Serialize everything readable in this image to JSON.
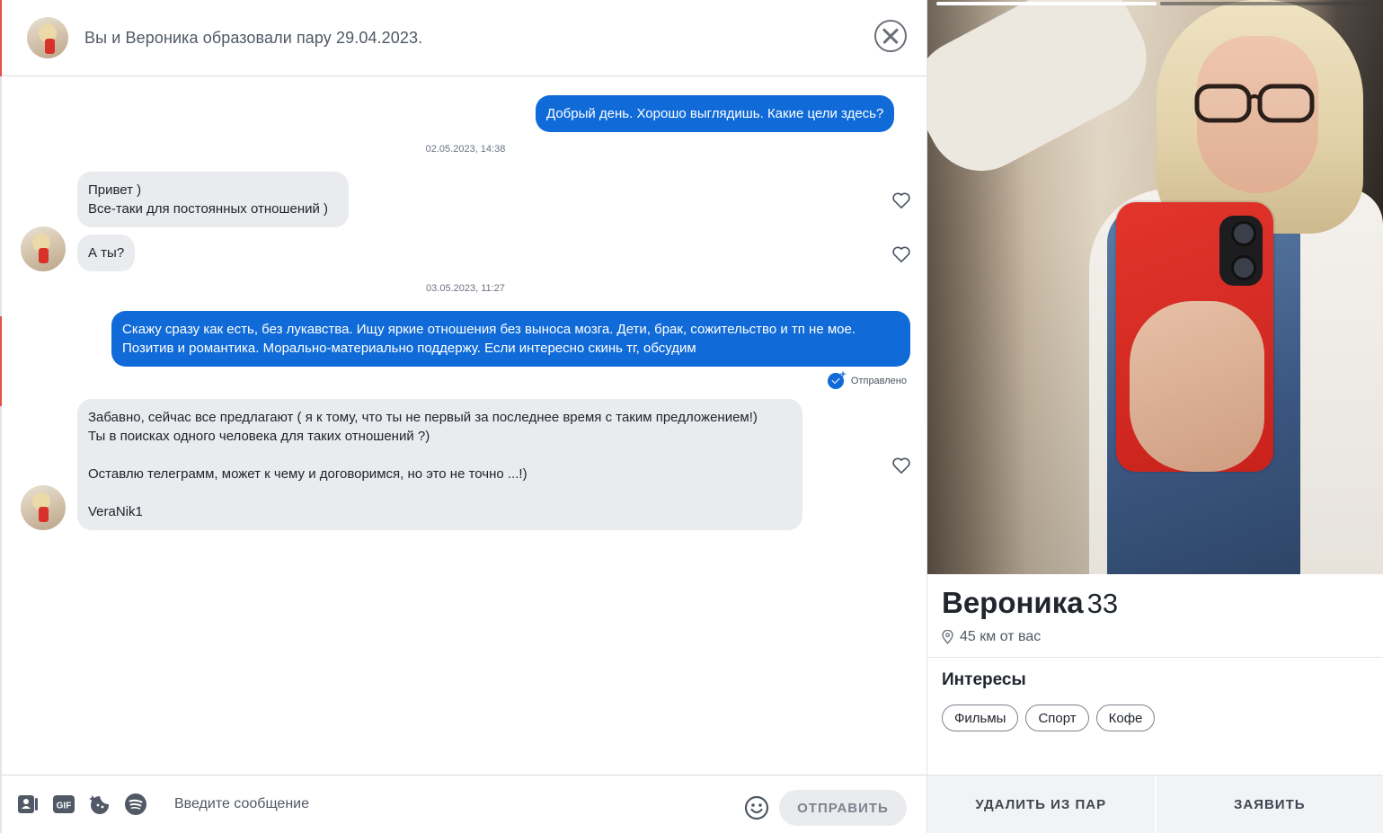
{
  "header": {
    "match_text": "Вы и Вероника образовали пару 29.04.2023."
  },
  "messages": {
    "m1": "Добрый день. Хорошо выглядишь. Какие цели здесь?",
    "stamp1": "02.05.2023, 14:38",
    "m2": "Привет )\nВсе-таки для постоянных отношений )",
    "m3": "А ты?",
    "stamp2": "03.05.2023, 11:27",
    "m4": "Скажу сразу как есть, без лукавства. Ищу яркие отношения без выноса мозга. Дети, брак, сожительство и тп не мое.\nПозитив и романтика. Морально-материально поддержу. Если интересно скинь тг, обсудим",
    "status": "Отправлено",
    "m5": "Забавно, сейчас все предлагают ( я к тому, что ты не первый за последнее время  с таким предложением!)\nТы в поисках одного человека для таких отношений ?)\n\nОставлю телеграмм, может к чему и договоримся, но это не точно ...!)\n\nVeraNik1"
  },
  "composer": {
    "gif_label": "GIF",
    "placeholder": "Введите сообщение",
    "send_label": "ОТПРАВИТЬ"
  },
  "profile": {
    "name": "Вероника",
    "age": "33",
    "distance": "45 км от вас",
    "interests_title": "Интересы",
    "interests": [
      "Фильмы",
      "Спорт",
      "Кофе"
    ],
    "photo_count": 2,
    "photo_active": 1
  },
  "actions": {
    "unmatch_label": "УДАЛИТЬ ИЗ ПАР",
    "report_label": "ЗАЯВИТЬ"
  },
  "colors": {
    "accent_blue": "#106bd8",
    "incoming_bubble": "#e9ebee",
    "brand_red": "#e2504a"
  }
}
